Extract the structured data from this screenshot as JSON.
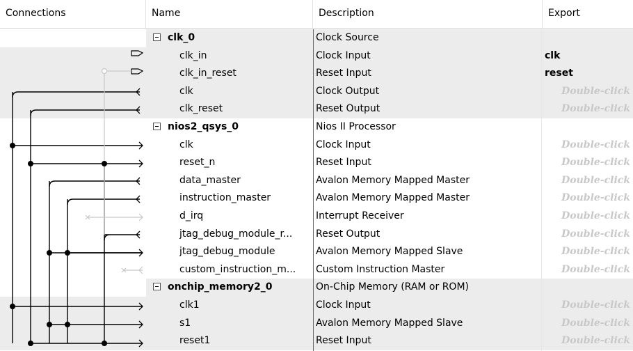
{
  "header": {
    "connections": "Connections",
    "name": "Name",
    "description": "Description",
    "export": "Export"
  },
  "export_hint": "Double-click",
  "rows": [
    {
      "name": "clk_0",
      "description": "Clock Source",
      "type": "parent"
    },
    {
      "name": "clk_in",
      "description": "Clock Input",
      "export": "clk",
      "type": "child"
    },
    {
      "name": "clk_in_reset",
      "description": "Reset Input",
      "export": "reset",
      "type": "child"
    },
    {
      "name": "clk",
      "description": "Clock Output",
      "type": "child"
    },
    {
      "name": "clk_reset",
      "description": "Reset Output",
      "type": "child"
    },
    {
      "name": "nios2_qsys_0",
      "description": "Nios II Processor",
      "type": "parent"
    },
    {
      "name": "clk",
      "description": "Clock Input",
      "type": "child"
    },
    {
      "name": "reset_n",
      "description": "Reset Input",
      "type": "child"
    },
    {
      "name": "data_master",
      "description": "Avalon Memory Mapped Master",
      "type": "child"
    },
    {
      "name": "instruction_master",
      "description": "Avalon Memory Mapped Master",
      "type": "child"
    },
    {
      "name": "d_irq",
      "description": "Interrupt Receiver",
      "type": "child"
    },
    {
      "name": "jtag_debug_module_r...",
      "description": "Reset Output",
      "type": "child"
    },
    {
      "name": "jtag_debug_module",
      "description": "Avalon Memory Mapped Slave",
      "type": "child"
    },
    {
      "name": "custom_instruction_m...",
      "description": "Custom Instruction Master",
      "type": "child"
    },
    {
      "name": "onchip_memory2_0",
      "description": "On-Chip Memory (RAM or ROM)",
      "type": "parent"
    },
    {
      "name": "clk1",
      "description": "Clock Input",
      "type": "child"
    },
    {
      "name": "s1",
      "description": "Avalon Memory Mapped Slave",
      "type": "child"
    },
    {
      "name": "reset1",
      "description": "Reset Input",
      "type": "child"
    }
  ],
  "colors": {
    "shade": "#ececec",
    "hint": "#c8c8c8",
    "wire": "#000000",
    "disabled_wire": "#c8c8c8"
  }
}
